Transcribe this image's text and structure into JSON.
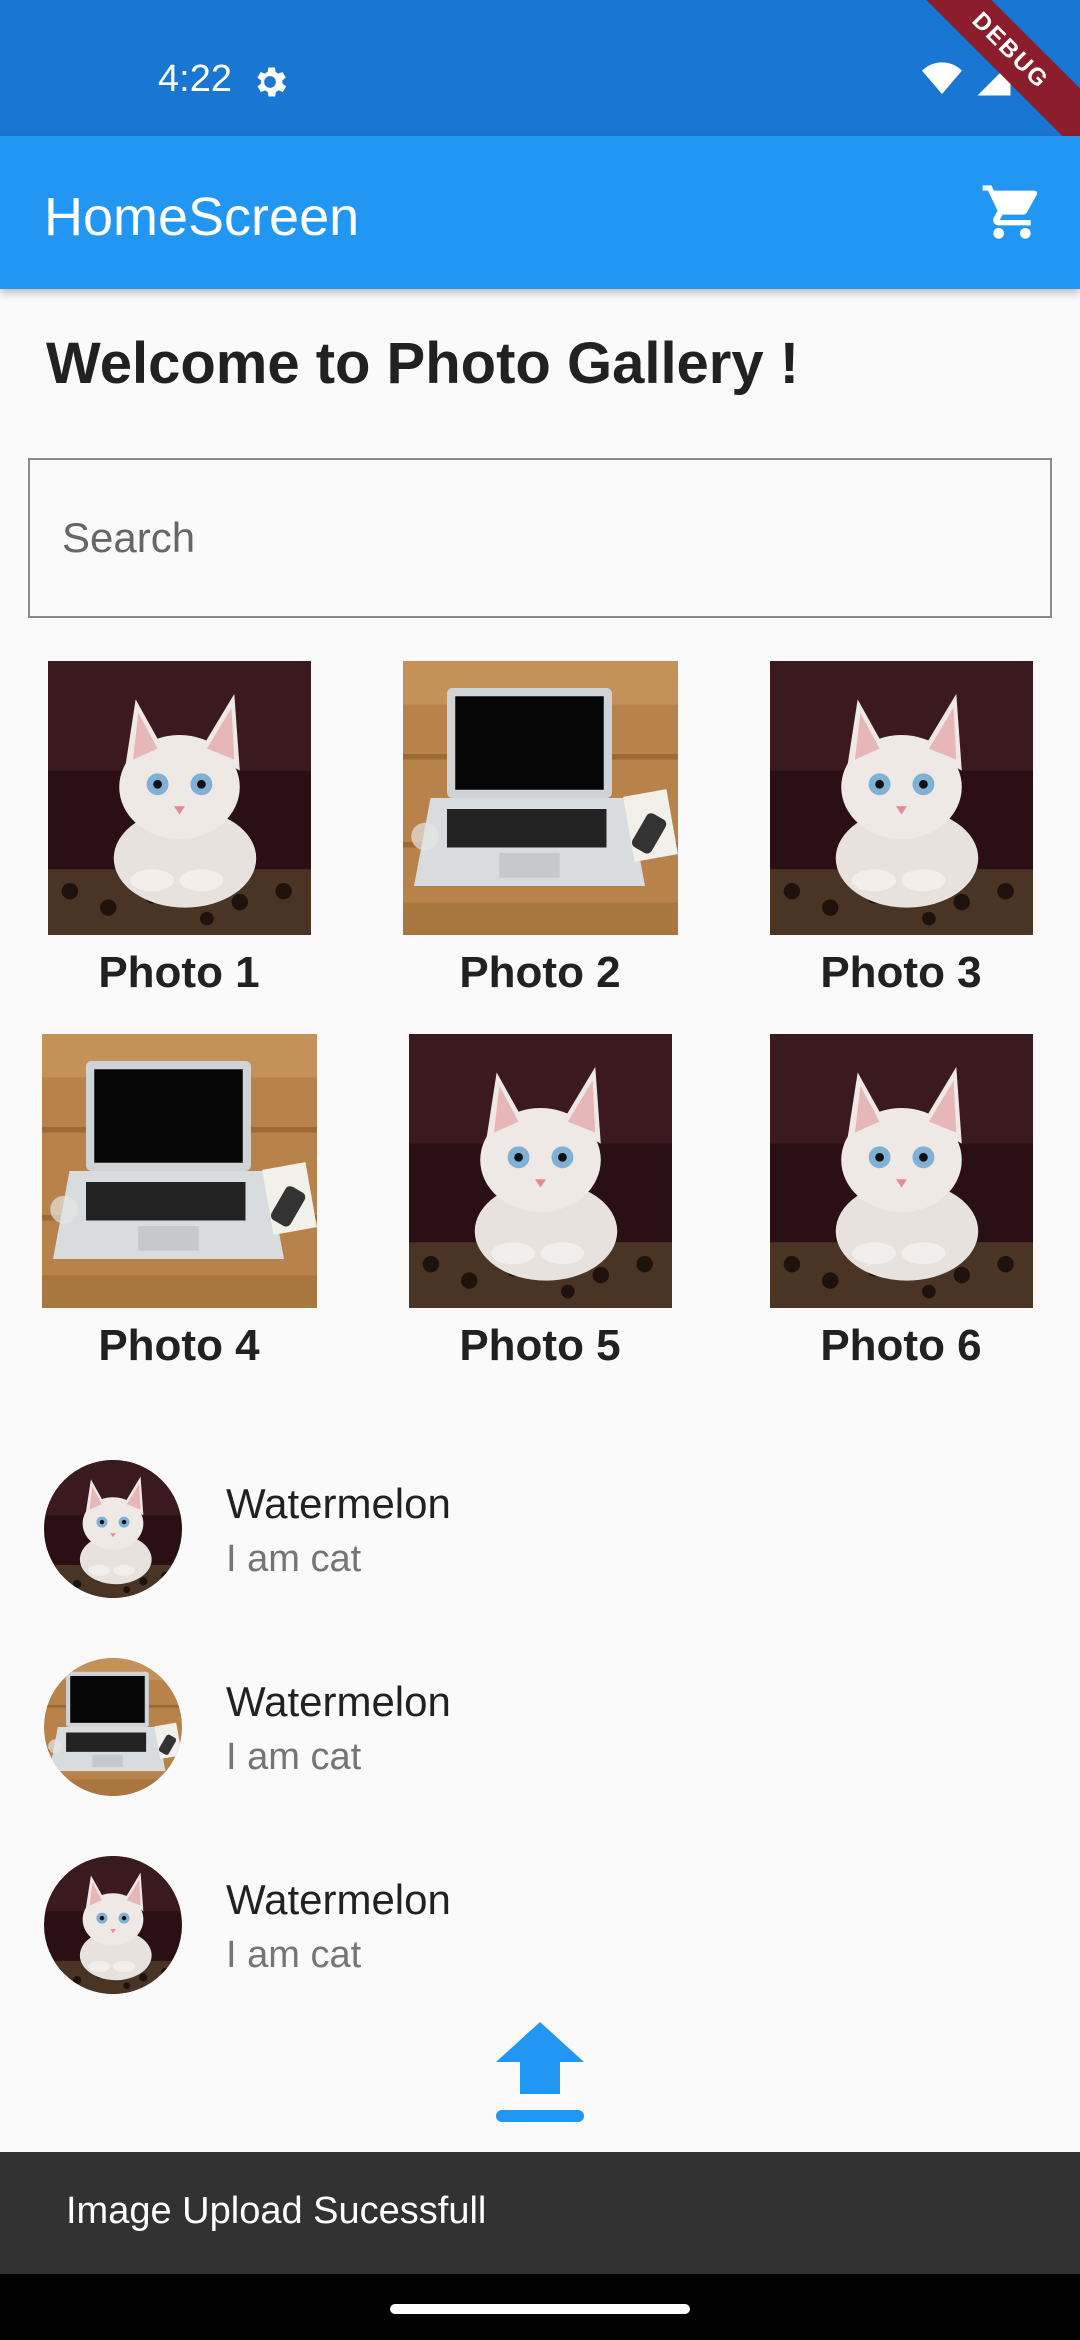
{
  "status_bar": {
    "time": "4:22",
    "icons": [
      "settings-gear-icon",
      "wifi-icon",
      "signal-icon",
      "battery-icon"
    ],
    "debug_label": "DEBUG"
  },
  "app_bar": {
    "title": "HomeScreen",
    "action_icon": "shopping-cart-icon",
    "color": "#2196f3"
  },
  "welcome_text": "Welcome to Photo Gallery !",
  "search": {
    "placeholder": "Search",
    "value": ""
  },
  "photos": [
    {
      "label": "Photo 1",
      "image": "cat"
    },
    {
      "label": "Photo 2",
      "image": "laptop"
    },
    {
      "label": "Photo 3",
      "image": "cat"
    },
    {
      "label": "Photo 4",
      "image": "laptop"
    },
    {
      "label": "Photo 5",
      "image": "cat"
    },
    {
      "label": "Photo 6",
      "image": "cat"
    }
  ],
  "list": [
    {
      "title": "Watermelon",
      "subtitle": "I am cat",
      "image": "cat"
    },
    {
      "title": "Watermelon",
      "subtitle": "I am cat",
      "image": "laptop"
    },
    {
      "title": "Watermelon",
      "subtitle": "I am cat",
      "image": "cat"
    }
  ],
  "upload_icon": "upload-icon",
  "snackbar": {
    "message": "Image Upload Sucessfull"
  }
}
